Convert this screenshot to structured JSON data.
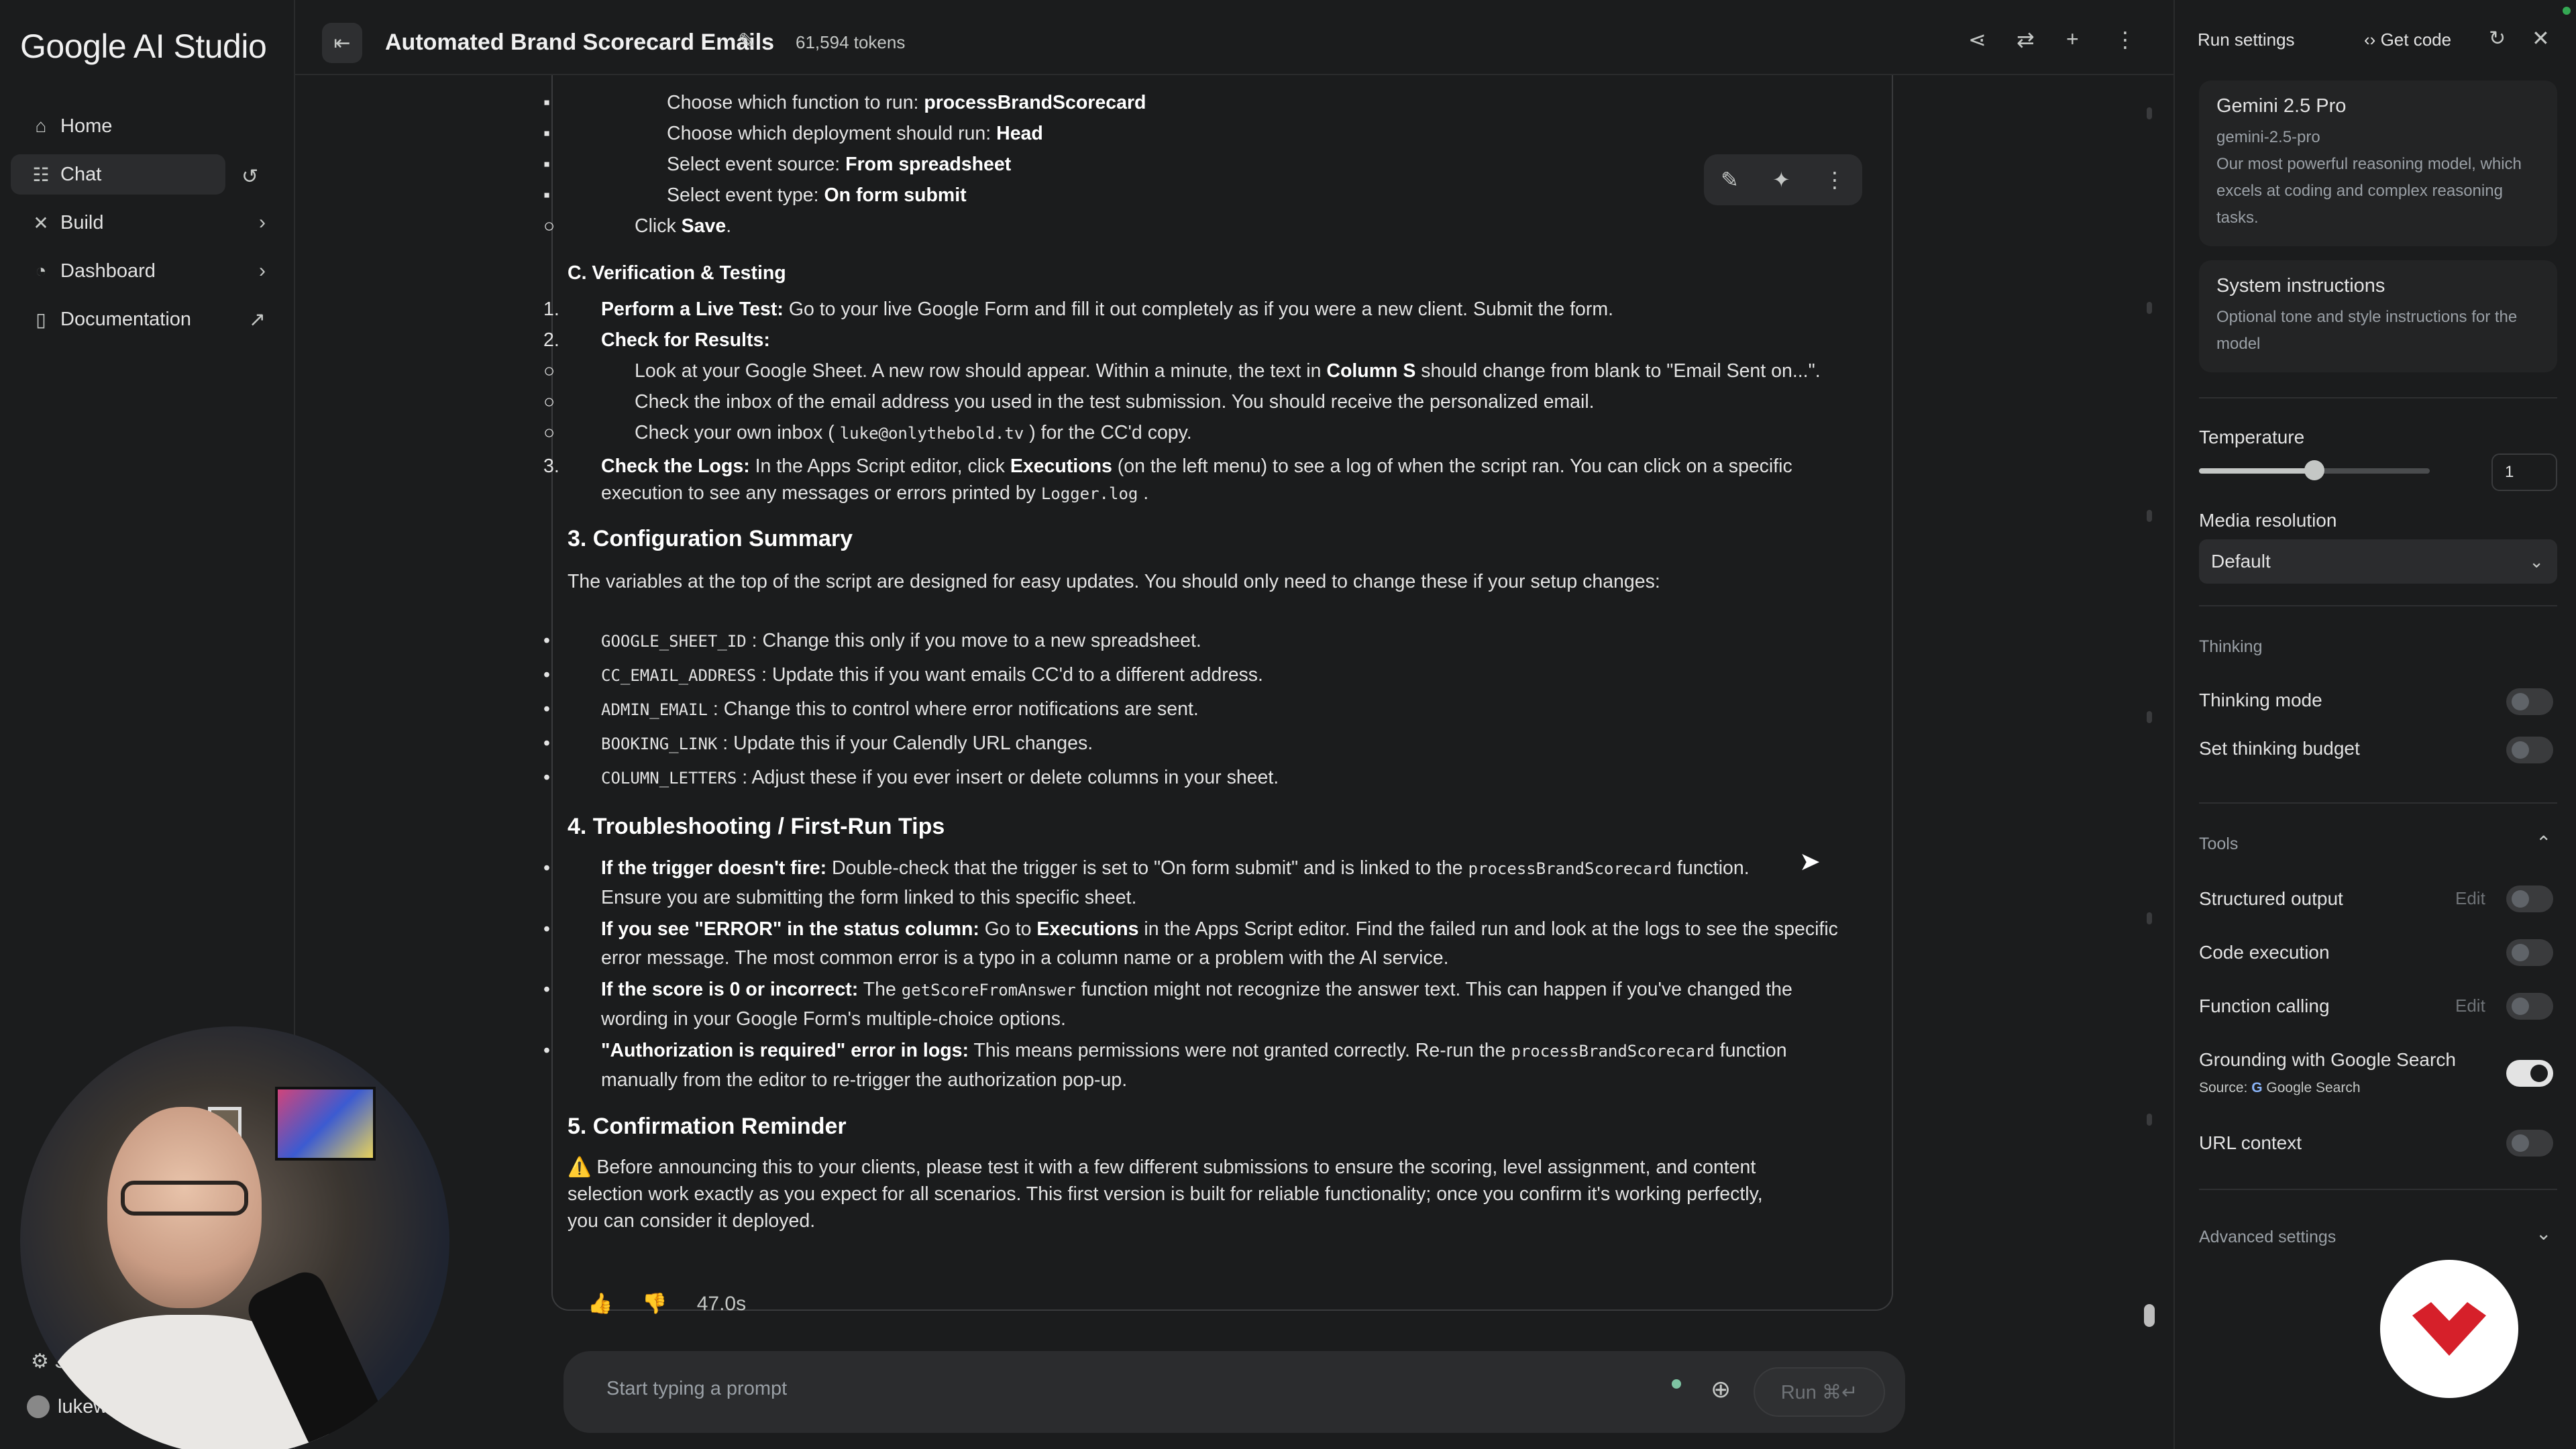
{
  "app": {
    "name": "Google AI Studio"
  },
  "sidebar": {
    "items": [
      {
        "label": "Home",
        "icon": "home-icon"
      },
      {
        "label": "Chat",
        "icon": "chat-icon"
      },
      {
        "label": "Build",
        "icon": "build-icon"
      },
      {
        "label": "Dashboard",
        "icon": "dashboard-icon"
      },
      {
        "label": "Documentation",
        "icon": "documentation-icon"
      }
    ],
    "footer_settings": "S",
    "footer_user": "lukew"
  },
  "topbar": {
    "title": "Automated Brand Scorecard Emails",
    "tokens": "61,594 tokens"
  },
  "message": {
    "lines": {
      "l1_pre": "Choose which function to run: ",
      "l1_b": "processBrandScorecard",
      "l2_pre": "Choose which deployment should run: ",
      "l2_b": "Head",
      "l3_pre": "Select event source: ",
      "l3_b": "From spreadsheet",
      "l4_pre": "Select event type: ",
      "l4_b": "On form submit",
      "l5_pre": "Click ",
      "l5_b": "Save",
      "l5_post": "."
    },
    "section_c": "C. Verification & Testing",
    "c1_b": "Perform a Live Test:",
    "c1_t": " Go to your live Google Form and fill it out completely as if you were a new client. Submit the form.",
    "c2_b": "Check for Results:",
    "c2a_pre": "Look at your Google Sheet. A new row should appear. Within a minute, the text in ",
    "c2a_b": "Column S",
    "c2a_post": " should change from blank to \"Email Sent on...\".",
    "c2b": "Check the inbox of the email address you used in the test submission. You should receive the personalized email.",
    "c2c_pre": "Check your own inbox ( ",
    "c2c_code": "luke@onlythebold.tv",
    "c2c_post": " ) for the CC'd copy.",
    "c3_b": "Check the Logs:",
    "c3_t1": " In the Apps Script editor, click ",
    "c3_b2": "Executions",
    "c3_t2": " (on the left menu) to see a log of when the script ran. You can click on a specific",
    "c3_t3": "execution to see any messages or errors printed by ",
    "c3_code": "Logger.log",
    "c3_t4": " .",
    "h3": "3. Configuration Summary",
    "h3_para": "The variables at the top of the script are designed for easy updates. You should only need to change these if your setup changes:",
    "config": [
      {
        "code": "GOOGLE_SHEET_ID",
        "text": " : Change this only if you move to a new spreadsheet."
      },
      {
        "code": "CC_EMAIL_ADDRESS",
        "text": " : Update this if you want emails CC'd to a different address."
      },
      {
        "code": "ADMIN_EMAIL",
        "text": " : Change this to control where error notifications are sent."
      },
      {
        "code": "BOOKING_LINK",
        "text": " : Update this if your Calendly URL changes."
      },
      {
        "code": "COLUMN_LETTERS",
        "text": " : Adjust these if you ever insert or delete columns in your sheet."
      }
    ],
    "h4": "4. Troubleshooting / First-Run Tips",
    "t1_b": "If the trigger doesn't fire:",
    "t1_a": " Double-check that the trigger is set to \"On form submit\" and is linked to the ",
    "t1_code": "processBrandScorecard",
    "t1_b2": " function.",
    "t1_c": "Ensure you are submitting the form linked to this specific sheet.",
    "t2_b": "If you see \"ERROR\" in the status column:",
    "t2_a": " Go to ",
    "t2_b2": "Executions",
    "t2_c": " in the Apps Script editor. Find the failed run and look at the logs to see the specific",
    "t2_d": "error message. The most common error is a typo in a column name or a problem with the AI service.",
    "t3_b": "If the score is 0 or incorrect:",
    "t3_a": " The ",
    "t3_code": "getScoreFromAnswer",
    "t3_c": " function might not recognize the answer text. This can happen if you've changed the",
    "t3_d": "wording in your Google Form's multiple-choice options.",
    "t4_b": "\"Authorization is required\" error in logs:",
    "t4_a": " This means permissions were not granted correctly. Re-run the ",
    "t4_code": "processBrandScorecard",
    "t4_c": " function",
    "t4_d": "manually from the editor to re-trigger the authorization pop-up.",
    "h5": "5. Confirmation Reminder",
    "h5_warn": "⚠️",
    "h5_l1": " Before announcing this to your clients, please test it with a few different submissions to ensure the scoring, level assignment, and content",
    "h5_l2": "selection work exactly as you expect for all scenarios. This first version is built for reliable functionality; once you confirm it's working perfectly,",
    "h5_l3": "you can consider it deployed.",
    "time": "47.0s"
  },
  "prompt": {
    "placeholder": "Start typing a prompt",
    "run_label": "Run ⌘↵"
  },
  "run_settings": {
    "title": "Run settings",
    "get_code": "Get code",
    "model_name": "Gemini 2.5 Pro",
    "model_id": "gemini-2.5-pro",
    "model_desc": "Our most powerful reasoning model, which excels at coding and complex reasoning tasks.",
    "system_title": "System instructions",
    "system_desc": "Optional tone and style instructions for the model",
    "temperature_label": "Temperature",
    "temperature_value": "1",
    "temperature_fraction": 0.5,
    "media_label": "Media resolution",
    "media_value": "Default",
    "thinking_section": "Thinking",
    "thinking_mode": "Thinking mode",
    "thinking_budget": "Set thinking budget",
    "tools_section": "Tools",
    "structured_output": "Structured output",
    "code_execution": "Code execution",
    "function_calling": "Function calling",
    "grounding": "Grounding with Google Search",
    "grounding_source_pre": "Source: ",
    "grounding_source": "Google Search",
    "url_context": "URL context",
    "edit": "Edit",
    "advanced": "Advanced settings",
    "toggles": {
      "thinking_mode": false,
      "thinking_budget": false,
      "structured_output": false,
      "code_execution": false,
      "function_calling": false,
      "grounding": true,
      "url_context": false
    }
  },
  "colors": {
    "accent": "#e3e3e3",
    "brand_red": "#d6202a",
    "status_green": "#34a853"
  }
}
